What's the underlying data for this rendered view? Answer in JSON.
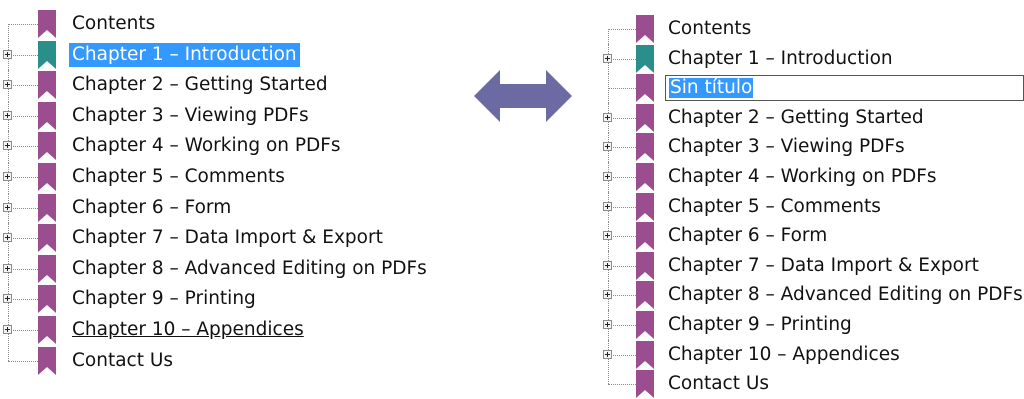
{
  "colors": {
    "bookmark": "#9a4d8f",
    "bookmark_active": "#2a8f8a",
    "selection": "#3399ff",
    "arrow": "#6b6aa3"
  },
  "arrow_icon": "double-headed-arrow-icon",
  "left_panel": {
    "items": [
      {
        "label": "Contents",
        "expandable": false
      },
      {
        "label": "Chapter 1 – Introduction",
        "expandable": true
      },
      {
        "label": "Chapter 2 – Getting Started",
        "expandable": true
      },
      {
        "label": "Chapter 3 – Viewing PDFs",
        "expandable": true
      },
      {
        "label": "Chapter 4 – Working on PDFs",
        "expandable": true
      },
      {
        "label": "Chapter 5 – Comments",
        "expandable": true
      },
      {
        "label": "Chapter 6 – Form",
        "expandable": true
      },
      {
        "label": "Chapter 7 – Data Import & Export",
        "expandable": true
      },
      {
        "label": "Chapter 8 – Advanced Editing on PDFs",
        "expandable": true
      },
      {
        "label": "Chapter 9 – Printing",
        "expandable": true
      },
      {
        "label": "Chapter 10 – Appendices",
        "expandable": true
      },
      {
        "label": "Contact Us",
        "expandable": false
      }
    ]
  },
  "right_panel": {
    "items": [
      {
        "label": "Contents",
        "expandable": false
      },
      {
        "label": "Chapter 1 – Introduction",
        "expandable": true
      },
      {
        "label": "Sin título",
        "expandable": false
      },
      {
        "label": "Chapter 2 – Getting Started",
        "expandable": true
      },
      {
        "label": "Chapter 3 – Viewing PDFs",
        "expandable": true
      },
      {
        "label": "Chapter 4 – Working on PDFs",
        "expandable": true
      },
      {
        "label": "Chapter 5 – Comments",
        "expandable": true
      },
      {
        "label": "Chapter 6 – Form",
        "expandable": true
      },
      {
        "label": "Chapter 7 – Data Import & Export",
        "expandable": true
      },
      {
        "label": "Chapter 8 – Advanced Editing on PDFs",
        "expandable": true
      },
      {
        "label": "Chapter 9 – Printing",
        "expandable": true
      },
      {
        "label": "Chapter 10 – Appendices",
        "expandable": true
      },
      {
        "label": "Contact Us",
        "expandable": false
      }
    ]
  }
}
